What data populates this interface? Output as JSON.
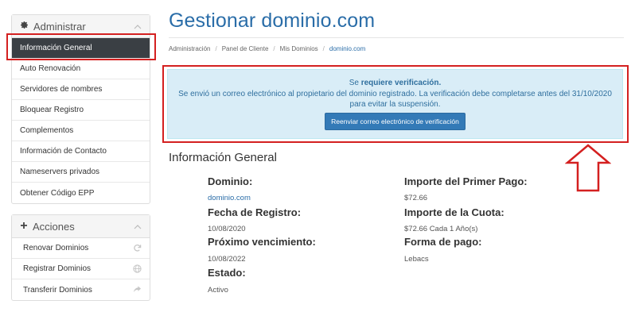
{
  "sidebar": {
    "admin": {
      "title": "Administrar",
      "items": [
        {
          "label": "Información General"
        },
        {
          "label": "Auto Renovación"
        },
        {
          "label": "Servidores de nombres"
        },
        {
          "label": "Bloquear Registro"
        },
        {
          "label": "Complementos"
        },
        {
          "label": "Información de Contacto"
        },
        {
          "label": "Nameservers privados"
        },
        {
          "label": "Obtener Código EPP"
        }
      ]
    },
    "actions": {
      "title": "Acciones",
      "items": [
        {
          "label": "Renovar Dominios",
          "icon": "refresh-icon"
        },
        {
          "label": "Registrar Dominios",
          "icon": "globe-icon"
        },
        {
          "label": "Transferir Dominios",
          "icon": "share-arrow-icon"
        }
      ]
    }
  },
  "header": {
    "title": "Gestionar dominio.com"
  },
  "breadcrumb": [
    "Administración",
    "Panel de Cliente",
    "Mis Dominios",
    "dominio.com"
  ],
  "alert": {
    "line1_prefix": "Se",
    "line1_bold": "requiere verificación.",
    "line2": "Se envió un correo electrónico al propietario del dominio registrado. La verificación debe completarse antes del 31/10/2020",
    "line3": "para evitar la suspensión.",
    "button": "Reenviar correo electrónico de verificación"
  },
  "info": {
    "section_title": "Información General",
    "domain_label": "Dominio:",
    "domain_value": "dominio.com",
    "reg_date_label": "Fecha de Registro:",
    "reg_date_value": "10/08/2020",
    "next_due_label": "Próximo vencimiento:",
    "next_due_value": "10/08/2022",
    "status_label": "Estado:",
    "status_value": "Activo",
    "first_payment_label": "Importe del Primer Pago:",
    "first_payment_value": "$72.66",
    "recurring_label": "Importe de la Cuota:",
    "recurring_value": "$72.66 Cada 1 Año(s)",
    "payment_method_label": "Forma de pago:",
    "payment_method_value": "Lebacs"
  },
  "colors": {
    "accent": "#2a6da8",
    "alert_bg": "#d9edf7",
    "highlight": "#d42020",
    "active_bg": "#3a3f44"
  }
}
